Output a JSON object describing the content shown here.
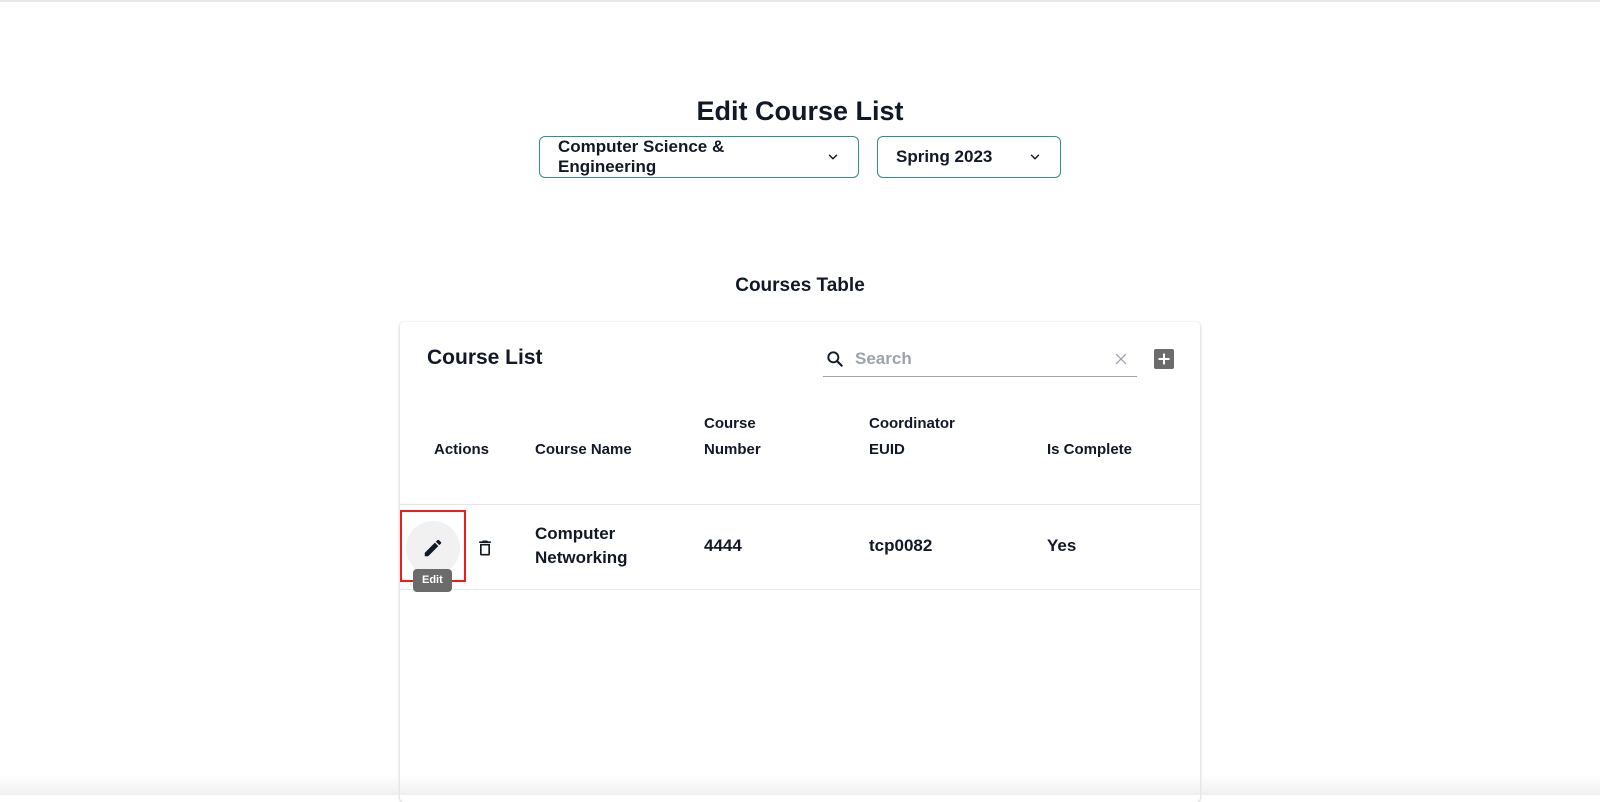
{
  "page": {
    "title": "Edit Course List"
  },
  "filters": {
    "department": "Computer Science & Engineering",
    "term": "Spring 2023"
  },
  "section": {
    "title": "Courses Table"
  },
  "table": {
    "title": "Course List",
    "search_placeholder": "Search",
    "columns": {
      "actions": "Actions",
      "course_name": "Course Name",
      "course_number_line1": "Course",
      "course_number_line2": "Number",
      "coordinator_line1": "Coordinator",
      "coordinator_line2": "EUID",
      "is_complete": "Is Complete"
    },
    "rows": [
      {
        "course_name_line1": "Computer",
        "course_name_line2": "Networking",
        "course_number": "4444",
        "coordinator": "tcp0082",
        "is_complete": "Yes"
      }
    ],
    "edit_tooltip": "Edit"
  },
  "icons": {
    "edit": "pencil-icon",
    "delete": "trash-icon",
    "search": "search-icon",
    "clear": "close-icon",
    "add": "plus-box-icon",
    "dropdown": "chevron-down-icon"
  },
  "colors": {
    "select_border": "#2f8f8a",
    "highlight": "#ee1c1c",
    "tooltip_bg": "#6b6b6b"
  }
}
